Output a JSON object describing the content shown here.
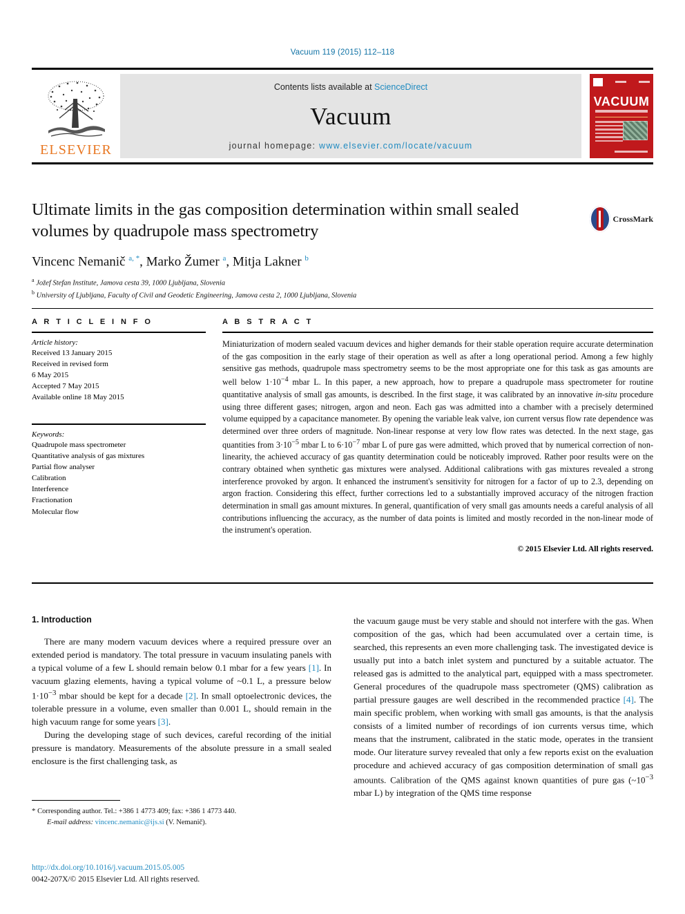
{
  "running_head": "Vacuum 119 (2015) 112–118",
  "masthead": {
    "publisher": "ELSEVIER",
    "contents_prefix": "Contents lists available at ",
    "contents_link": "ScienceDirect",
    "journal_name": "Vacuum",
    "homepage_prefix": "journal homepage: ",
    "homepage_url": "www.elsevier.com/locate/vacuum",
    "cover_title": "VACUUM",
    "accent_orange": "#e87722",
    "accent_blue": "#1f8ac0",
    "cover_red": "#c0191c",
    "band_gray": "#e4e4e4"
  },
  "article": {
    "title": "Ultimate limits in the gas composition determination within small sealed volumes by quadrupole mass spectrometry",
    "crossmark_label": "CrossMark",
    "authors_html": "Vincenc Nemanič <sup>a, *</sup>, Marko Žumer <sup>a</sup>, Mitja Lakner <sup>b</sup>",
    "affiliation_a": "Jožef Stefan Institute, Jamova cesta 39, 1000 Ljubljana, Slovenia",
    "affiliation_b": "University of Ljubljana, Faculty of Civil and Geodetic Engineering, Jamova cesta 2, 1000 Ljubljana, Slovenia"
  },
  "info": {
    "heading": "A R T I C L E   I N F O",
    "history_label": "Article history:",
    "history": [
      "Received 13 January 2015",
      "Received in revised form",
      "6 May 2015",
      "Accepted 7 May 2015",
      "Available online 18 May 2015"
    ],
    "keywords_label": "Keywords:",
    "keywords": [
      "Quadrupole mass spectrometer",
      "Quantitative analysis of gas mixtures",
      "Partial flow analyser",
      "Calibration",
      "Interference",
      "Fractionation",
      "Molecular flow"
    ]
  },
  "abstract": {
    "heading": "A B S T R A C T",
    "text_html": "Miniaturization of modern sealed vacuum devices and higher demands for their stable operation require accurate determination of the gas composition in the early stage of their operation as well as after a long operational period. Among a few highly sensitive gas methods, quadrupole mass spectrometry seems to be the most appropriate one for this task as gas amounts are well below 1·10<sup>−4</sup> mbar L. In this paper, a new approach, how to prepare a quadrupole mass spectrometer for routine quantitative analysis of small gas amounts, is described. In the first stage, it was calibrated by an innovative <i>in-situ</i> procedure using three different gases; nitrogen, argon and neon. Each gas was admitted into a chamber with a precisely determined volume equipped by a capacitance manometer. By opening the variable leak valve, ion current versus flow rate dependence was determined over three orders of magnitude. Non-linear response at very low flow rates was detected. In the next stage, gas quantities from 3·10<sup>−5</sup> mbar L to 6·10<sup>−7</sup> mbar L of pure gas were admitted, which proved that by numerical correction of non-linearity, the achieved accuracy of gas quantity determination could be noticeably improved. Rather poor results were on the contrary obtained when synthetic gas mixtures were analysed. Additional calibrations with gas mixtures revealed a strong interference provoked by argon. It enhanced the instrument's sensitivity for nitrogen for a factor of up to 2.3, depending on argon fraction. Considering this effect, further corrections led to a substantially improved accuracy of the nitrogen fraction determination in small gas amount mixtures. In general, quantification of very small gas amounts needs a careful analysis of all contributions influencing the accuracy, as the number of data points is limited and mostly recorded in the non-linear mode of the instrument's operation.",
    "copyright": "© 2015 Elsevier Ltd. All rights reserved."
  },
  "body": {
    "section_number_title": "1. Introduction",
    "left_par1_html": "There are many modern vacuum devices where a required pressure over an extended period is mandatory. The total pressure in vacuum insulating panels with a typical volume of a few L should remain below 0.1 mbar for a few years <span class=\"ref\">[1]</span>. In vacuum glazing elements, having a typical volume of ~0.1 L, a pressure below 1·10<sup>−3</sup> mbar should be kept for a decade <span class=\"ref\">[2]</span>. In small optoelectronic devices, the tolerable pressure in a volume, even smaller than 0.001 L, should remain in the high vacuum range for some years <span class=\"ref\">[3]</span>.",
    "left_par2_html": "During the developing stage of such devices, careful recording of the initial pressure is mandatory. Measurements of the absolute pressure in a small sealed enclosure is the first challenging task, as",
    "right_par_html": "the vacuum gauge must be very stable and should not interfere with the gas. When composition of the gas, which had been accumulated over a certain time, is searched, this represents an even more challenging task. The investigated device is usually put into a batch inlet system and punctured by a suitable actuator. The released gas is admitted to the analytical part, equipped with a mass spectrometer. General procedures of the quadrupole mass spectrometer (QMS) calibration as partial pressure gauges are well described in the recommended practice <span class=\"ref\">[4]</span>. The main specific problem, when working with small gas amounts, is that the analysis consists of a limited number of recordings of ion currents versus time, which means that the instrument, calibrated in the static mode, operates in the transient mode. Our literature survey revealed that only a few reports exist on the evaluation procedure and achieved accuracy of gas composition determination of small gas amounts. Calibration of the QMS against known quantities of pure gas (~10<sup>−3</sup> mbar L) by integration of the QMS time response"
  },
  "footnotes": {
    "corresponding_html": "<span class=\"star\">*</span> Corresponding author. Tel.: +386 1 4773 409; fax: +386 1 4773 440.",
    "email_html": "<span class=\"fn-email-label\">E-mail address:</span> <span class=\"fn-link\">vincenc.nemanic@ijs.si</span> (V. Nemanič).",
    "doi": "http://dx.doi.org/10.1016/j.vacuum.2015.05.005",
    "issn_line": "0042-207X/© 2015 Elsevier Ltd. All rights reserved."
  }
}
